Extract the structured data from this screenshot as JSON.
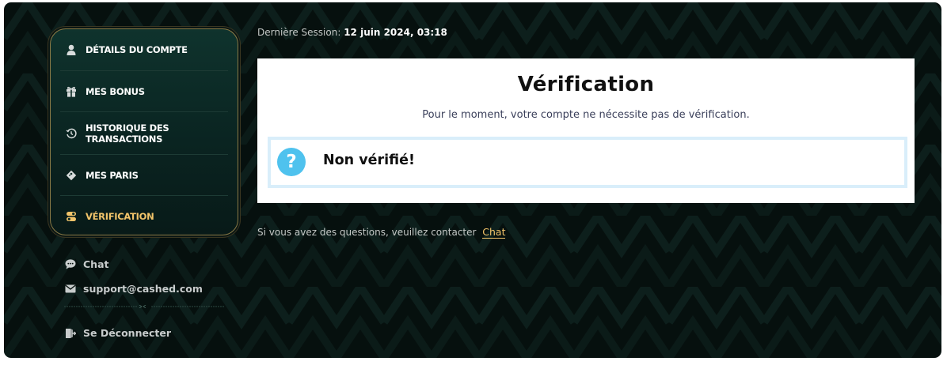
{
  "sidebar": {
    "menu": [
      {
        "label": "DÉTAILS DU COMPTE",
        "icon": "user-icon"
      },
      {
        "label": "MES BONUS",
        "icon": "gift-icon"
      },
      {
        "label": "HISTORIQUE DES TRANSACTIONS",
        "icon": "history-icon"
      },
      {
        "label": "MES PARIS",
        "icon": "ticket-icon"
      },
      {
        "label": "VÉRIFICATION",
        "icon": "toggle-icon",
        "active": true
      }
    ],
    "links": {
      "chat": "Chat",
      "email": "support@cashed.com",
      "logout": "Se Déconnecter"
    }
  },
  "main": {
    "session_label": "Dernière Session:",
    "session_value": "12 juin 2024, 03:18",
    "card": {
      "title": "Vérification",
      "subtitle": "Pour le moment, votre compte ne nécessite pas de vérification.",
      "status": "Non vérifié!",
      "status_icon": "?"
    },
    "contact_text": "Si vous avez des questions, veuillez contacter",
    "contact_link": "Chat"
  },
  "colors": {
    "accent": "#f2c46a",
    "background": "#06100e",
    "card": "#ffffff",
    "status_icon": "#4fc2ee",
    "status_border": "#d9eefa"
  }
}
